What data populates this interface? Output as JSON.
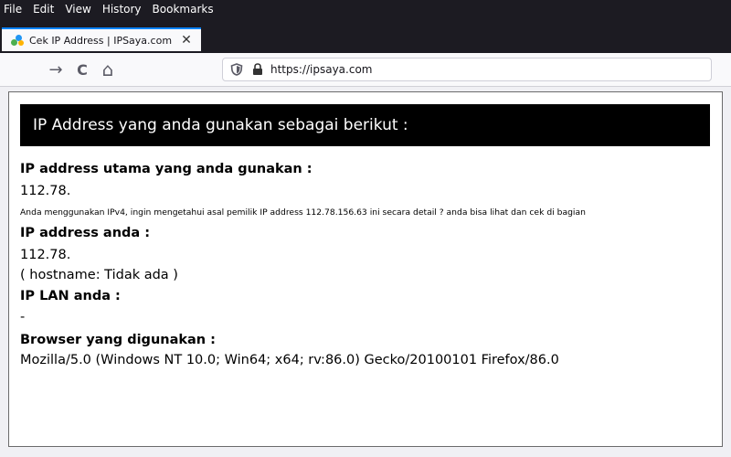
{
  "menu": [
    "File",
    "Edit",
    "View",
    "History",
    "Bookmarks"
  ],
  "tab": {
    "title": "Cek IP Address | IPSaya.com",
    "close": "✕"
  },
  "nav": {
    "back": "→",
    "reload": "C",
    "home": "⌂"
  },
  "url": "https://ipsaya.com",
  "page": {
    "banner": "IP Address yang anda gunakan sebagai berikut :",
    "main_ip_heading": "IP address utama yang anda gunakan :",
    "main_ip_value": "112.78.",
    "info_text": "Anda menggunakan IPv4, ingin mengetahui asal pemilik IP address 112.78.156.63 ini secara detail ? anda bisa lihat dan cek di bagian",
    "ip_heading": "IP address anda :",
    "ip_value": "112.78.",
    "hostname": "( hostname: Tidak ada )",
    "lan_heading": "IP LAN anda :",
    "lan_value": "-",
    "browser_heading": "Browser yang digunakan :",
    "browser_value": "Mozilla/5.0 (Windows NT 10.0; Win64; x64; rv:86.0) Gecko/20100101 Firefox/86.0"
  },
  "colors": {
    "chrome_dark": "#1c1b22",
    "tab_accent": "#0a84ff",
    "banner_bg": "#000000"
  }
}
